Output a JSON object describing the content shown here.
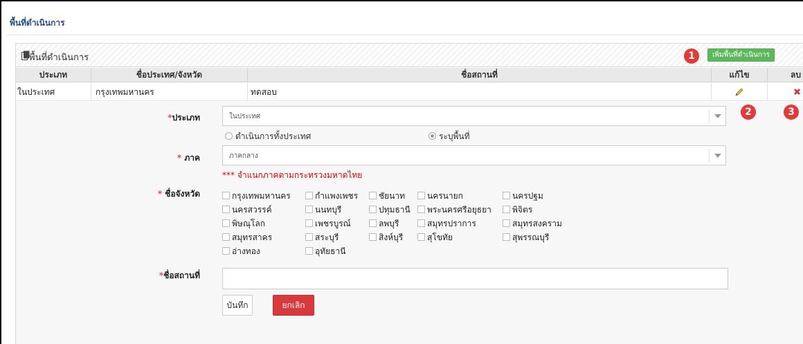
{
  "page_title": "พื้นที่ดำเนินการ",
  "panel": {
    "title": "พื้นที่ดำเนินการ",
    "add_button": "เพิ่มพื้นที่ดำเนินการ"
  },
  "badges": [
    "1",
    "2",
    "3"
  ],
  "table": {
    "headers": [
      "ประเภท",
      "ชื่อประเทศ/จังหวัด",
      "ชื่อสถานที่",
      "แก้ไข",
      "ลบ"
    ],
    "rows": [
      {
        "type": "ในประเทศ",
        "province": "กรุงเทพมหานคร",
        "place": "ทดสอบ"
      }
    ]
  },
  "form": {
    "type_label": "ประเภท",
    "type_value": "ในประเทศ",
    "radio_nationwide": "ดำเนินการทั้งประเทศ",
    "radio_specify": "ระบุพื้นที่",
    "region_label": " ภาค",
    "region_value": "ภาคกลาง",
    "region_note": "*** จำแนกภาคตามกระทรวงมหาดไทย",
    "province_label": " ชื่อจังหวัด",
    "provinces": [
      "กรุงเทพมหานคร",
      "กำแพงเพชร",
      "ชัยนาท",
      "นครนายก",
      "นครปฐม",
      "นครสวรรค์",
      "นนทบุรี",
      "ปทุมธานี",
      "พระนครศรีอยุธยา",
      "พิจิตร",
      "พิษณุโลก",
      "เพชรบูรณ์",
      "ลพบุรี",
      "สมุทรปราการ",
      "สมุทรสงคราม",
      "สมุทรสาคร",
      "สระบุรี",
      "สิงห์บุรี",
      "สุโขทัย",
      "สุพรรณบุรี",
      "อ่างทอง",
      "อุทัยธานี"
    ],
    "place_label": "ชื่อสถานที่",
    "place_value": "",
    "save_button": "บันทึก",
    "cancel_button": "ยกเลิก"
  },
  "colors": {
    "add_button": "#5cb85c",
    "cancel_button": "#d9393d",
    "badge": "#e53935",
    "note": "#e00000",
    "title": "#1f4e8c"
  }
}
